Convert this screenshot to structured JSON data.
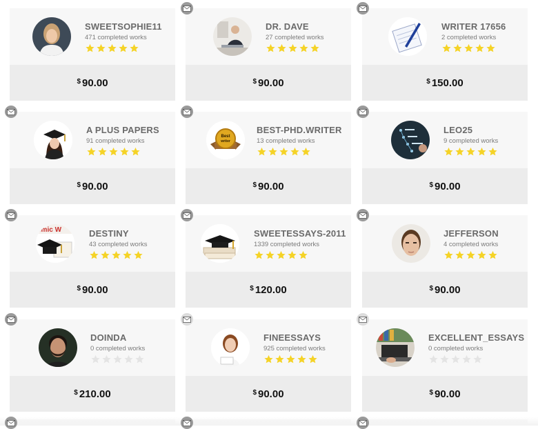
{
  "currency_symbol": "$",
  "star_color_filled": "#f5d327",
  "star_color_empty": "#e4e4e4",
  "writers": [
    {
      "name": "SWEETSOPHIE11",
      "works": "471 completed works",
      "price": "90.00",
      "rating": 5,
      "avatar_icon": "woman-portrait-avatar"
    },
    {
      "name": "DR. DAVE",
      "works": "27 completed works",
      "price": "90.00",
      "rating": 5,
      "avatar_icon": "man-at-laptop-avatar"
    },
    {
      "name": "WRITER 17656",
      "works": "2 completed works",
      "price": "150.00",
      "rating": 5,
      "avatar_icon": "notepad-pen-avatar"
    },
    {
      "name": "A PLUS PAPERS",
      "works": "91 completed works",
      "price": "90.00",
      "rating": 5,
      "avatar_icon": "graduate-avatar"
    },
    {
      "name": "BEST-PHD.WRITER",
      "works": "13 completed works",
      "price": "90.00",
      "rating": 5,
      "avatar_icon": "best-writer-badge-avatar"
    },
    {
      "name": "LEO25",
      "works": "9 completed works",
      "price": "90.00",
      "rating": 5,
      "avatar_icon": "vision-mission-board-avatar"
    },
    {
      "name": "DESTINY",
      "works": "43 completed works",
      "price": "90.00",
      "rating": 5,
      "avatar_icon": "academic-cap-avatar"
    },
    {
      "name": "SWEETESSAYS-2011",
      "works": "1339 completed works",
      "price": "120.00",
      "rating": 5,
      "avatar_icon": "cap-and-books-avatar"
    },
    {
      "name": "JEFFERSON",
      "works": "4 completed works",
      "price": "90.00",
      "rating": 5,
      "avatar_icon": "young-man-portrait-avatar"
    },
    {
      "name": "DOINDA",
      "works": "0 completed works",
      "price": "210.00",
      "rating": 0,
      "avatar_icon": "bearded-man-avatar"
    },
    {
      "name": "FINEESSAYS",
      "works": "925 completed works",
      "price": "90.00",
      "rating": 5,
      "avatar_icon": "woman-with-papers-avatar"
    },
    {
      "name": "EXCELLENT_ESSAYS",
      "works": "0 completed works",
      "price": "90.00",
      "rating": 0,
      "avatar_icon": "laptop-typing-avatar"
    }
  ]
}
